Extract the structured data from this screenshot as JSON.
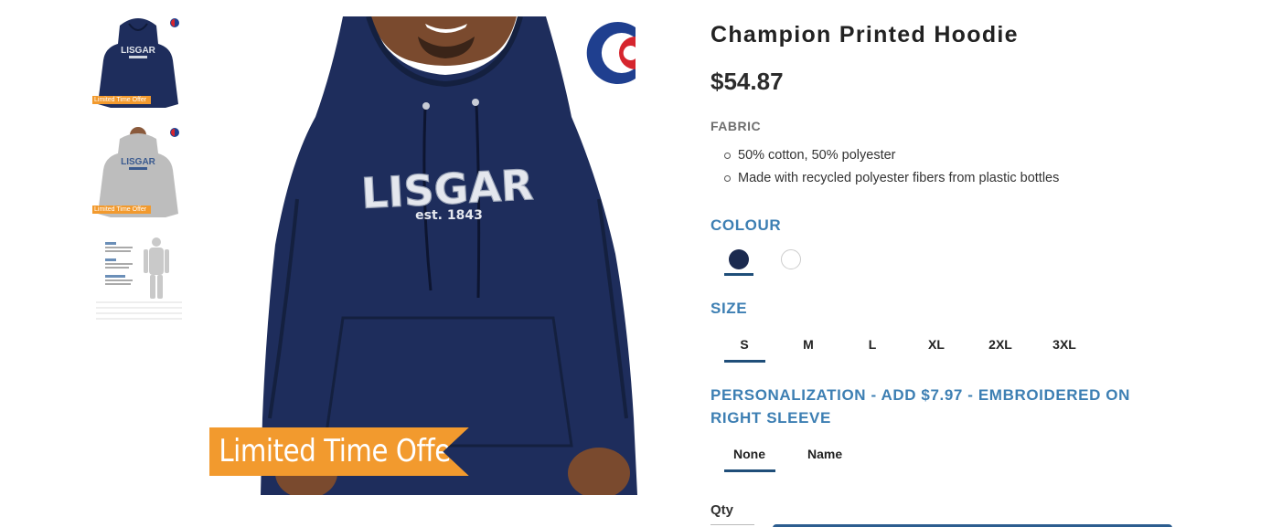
{
  "thumbnails": [
    {
      "name": "thumb-navy-hoodie",
      "badge": "Limited Time Offer",
      "text": "LISGAR"
    },
    {
      "name": "thumb-grey-hoodie",
      "badge": "Limited Time Offer",
      "text": "LISGAR"
    },
    {
      "name": "thumb-size-chart"
    }
  ],
  "main_image": {
    "print_line1": "LISGAR",
    "print_line2": "est. 1843",
    "offer_banner": "Limited Time Offer",
    "hoodie_color": "#1e2d5c",
    "brand_logo": "champion-logo"
  },
  "product": {
    "title": "Champion Printed Hoodie",
    "price": "$54.87",
    "fabric_heading": "FABRIC",
    "fabric_items": [
      "50% cotton, 50% polyester",
      "Made with recycled polyester fibers from plastic bottles"
    ]
  },
  "colour": {
    "heading": "COLOUR",
    "options": [
      {
        "name": "navy",
        "hex": "#1b2a4f",
        "selected": true
      },
      {
        "name": "white",
        "hex": "#ffffff",
        "selected": false
      }
    ]
  },
  "size": {
    "heading": "SIZE",
    "options": [
      "S",
      "M",
      "L",
      "XL",
      "2XL",
      "3XL"
    ],
    "selected": "S"
  },
  "personalization": {
    "heading": "PERSONALIZATION - ADD $7.97 - EMBROIDERED ON RIGHT SLEEVE",
    "options": [
      "None",
      "Name"
    ],
    "selected": "None"
  },
  "quantity": {
    "label": "Qty"
  },
  "colors": {
    "accent": "#3d7fb3",
    "underline": "#1f4e79",
    "offer_orange": "#f29a2e"
  }
}
